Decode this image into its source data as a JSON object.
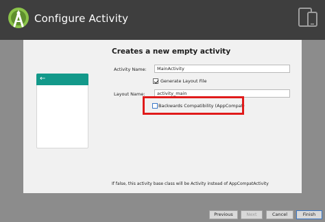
{
  "window": {
    "title": "Configure Activity"
  },
  "icons": {
    "logo": "android-studio-logo-icon",
    "devices": "devices-icon",
    "back": "back-arrow-icon"
  },
  "form": {
    "heading": "Creates a new empty activity",
    "activity_name_label": "Activity Name:",
    "activity_name_value": "MainActivity",
    "generate_layout_label": "Generate Layout File",
    "generate_layout_checked": true,
    "layout_name_label": "Layout Name:",
    "layout_name_value": "activity_main",
    "backwards_compat_label": "Backwards Compatibility (AppCompat)",
    "backwards_compat_checked": false,
    "footnote": "If false, this activity base class will be Activity instead of AppCompatActivity"
  },
  "buttons": {
    "previous": "Previous",
    "next": "Next",
    "cancel": "Cancel",
    "finish": "Finish"
  },
  "colors": {
    "header_bg": "#3e3e3e",
    "preview_bar": "#13998a",
    "highlight": "#e01a1a",
    "logo_green": "#8bc34a"
  }
}
